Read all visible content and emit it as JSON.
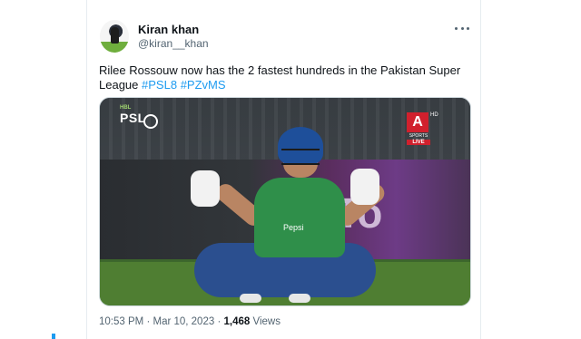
{
  "tweet": {
    "author": {
      "display_name": "Kiran khan",
      "handle": "@kiran__khan"
    },
    "text": {
      "main": "Rilee Rossouw now has the 2 fastest hundreds in the Pakistan Super League",
      "hashtags": [
        "#PSL8",
        "#PZvMS"
      ]
    },
    "media": {
      "league_logo_text": "PSL",
      "league_sub": "HBL",
      "channel_letter": "A",
      "channel_hd": "HD",
      "channel_name": "SPORTS",
      "channel_status": "LIVE",
      "board_text": "kTo",
      "shirt_sponsor": "Pepsi"
    },
    "meta": {
      "time": "10:53 PM",
      "separator": "·",
      "date": "Mar 10, 2023",
      "views_count": "1,468",
      "views_label": "Views"
    }
  },
  "icons": {
    "more": "more-dots-icon"
  },
  "colors": {
    "accent": "#1d9bf0",
    "text": "#0f1419",
    "muted": "#536471"
  }
}
